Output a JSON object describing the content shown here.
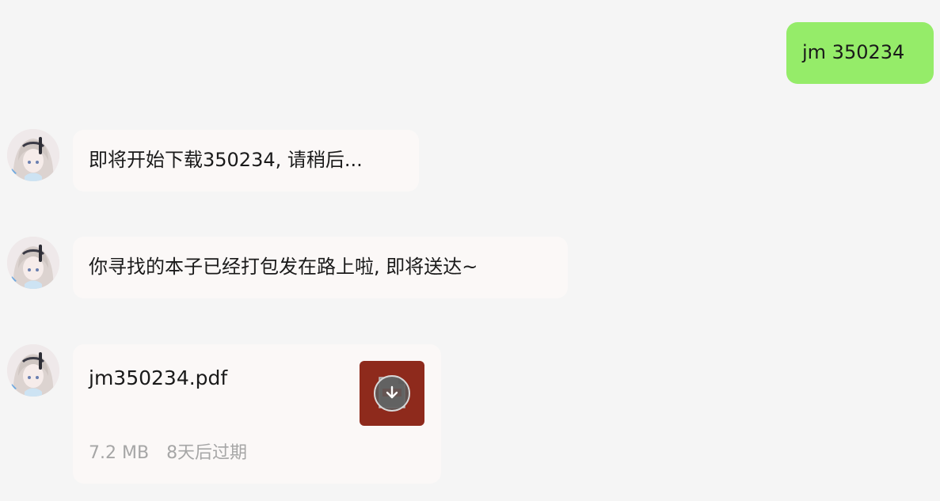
{
  "messages": {
    "outgoing": [
      {
        "text": "jm 350234"
      }
    ],
    "incoming": [
      {
        "text": "即将开始下载350234, 请稍后..."
      },
      {
        "text": "你寻找的本子已经打包发在路上啦, 即将送达~"
      }
    ],
    "file": {
      "name": "jm350234.pdf",
      "size": "7.2 MB",
      "expiry": "8天后过期",
      "thumb_icon": "pdf-icon",
      "thumb_color": "#8e2a1c",
      "action_icon": "download-icon"
    }
  },
  "colors": {
    "background": "#f5f5f5",
    "outgoing_bubble": "#95ec69",
    "incoming_bubble": "#fbf8f7",
    "meta_text": "#a6a6a6"
  }
}
